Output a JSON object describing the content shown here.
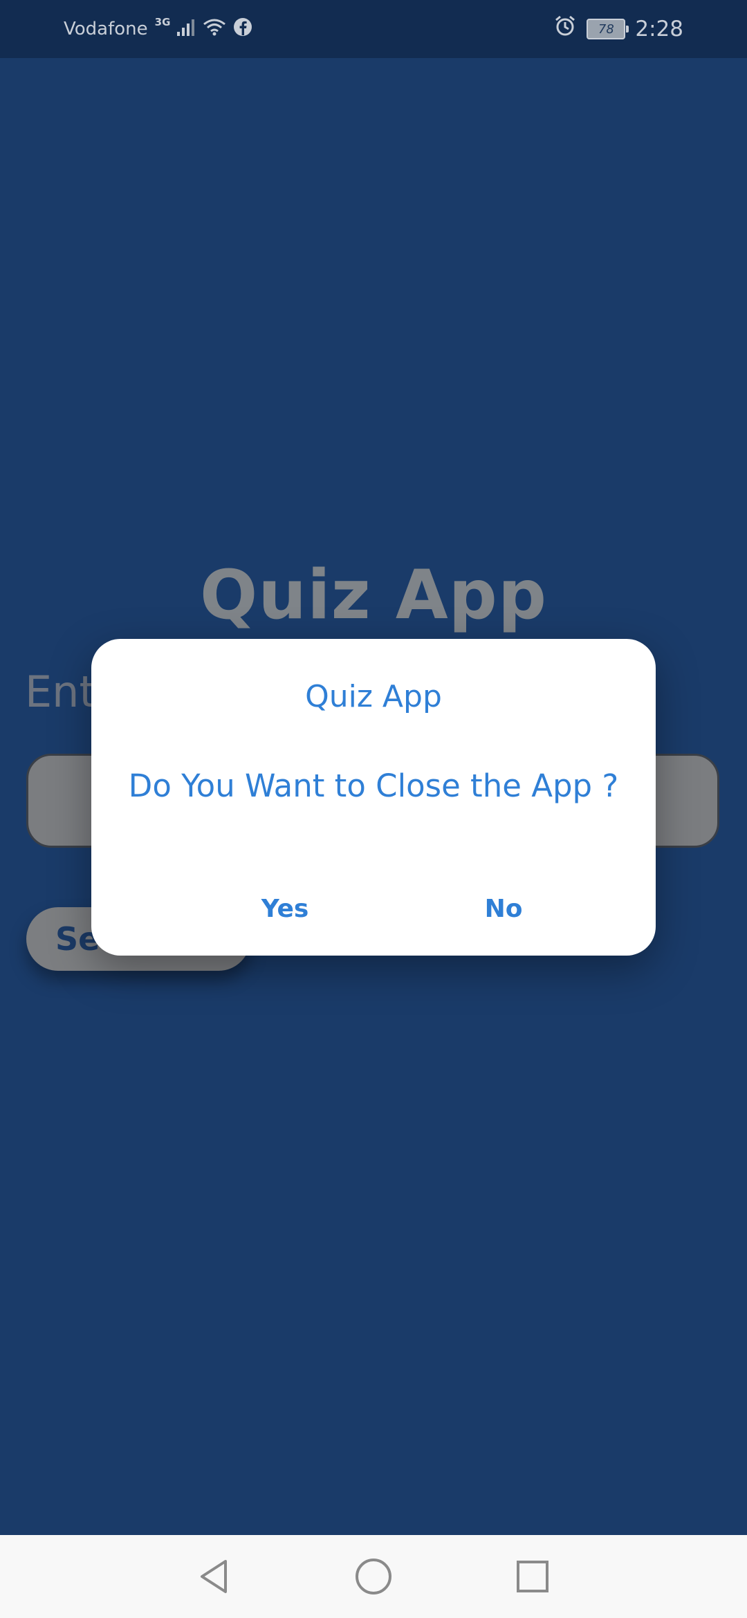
{
  "status_bar": {
    "carrier": "Vodafone",
    "network_type": "3G",
    "battery_level": "78",
    "time": "2:28",
    "icons": [
      "signal-icon",
      "wifi-icon",
      "facebook-icon",
      "alarm-icon",
      "battery-icon"
    ]
  },
  "app": {
    "title": "Quiz App",
    "name_label": "Ent",
    "start_button_label": "Se"
  },
  "dialog": {
    "title": "Quiz App",
    "message": "Do You Want to Close the App ?",
    "yes_label": "Yes",
    "no_label": "No",
    "accent_color": "#2f7fd6"
  },
  "nav_bar": {
    "icons": [
      "back-icon",
      "home-icon",
      "recents-icon"
    ]
  },
  "colors": {
    "background": "#1a3b69",
    "status_bar": "#122c51",
    "dialog_background": "#ffffff"
  }
}
